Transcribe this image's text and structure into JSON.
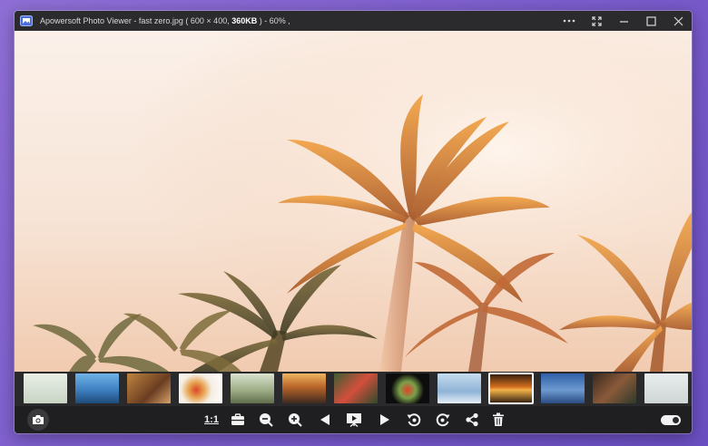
{
  "window": {
    "title_prefix": "Apowersoft Photo Viewer  - fast zero.jpg ( 600 × 400,",
    "title_size": " 360KB",
    "title_suffix": " )  - 60% ,"
  },
  "icons": {
    "app": "photo-viewer-app-icon",
    "more": "more-dots-icon",
    "fullscreen": "fullscreen-icon",
    "minimize": "minimize-icon",
    "maximize": "maximize-icon",
    "close": "close-icon"
  },
  "toolbar": {
    "actual_size_label": "1:1"
  },
  "colors": {
    "window_bg": "#1f1f22",
    "titlebar_bg": "#2b2b2e",
    "desktop_bg": "#7b5ccc",
    "strip_bg": "#2a2a2d"
  }
}
